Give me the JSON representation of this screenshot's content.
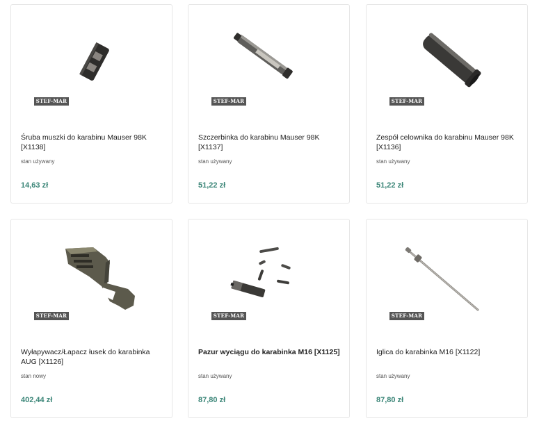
{
  "products": [
    {
      "title": "Śruba muszki do karabinu Mauser 98K [X1138]",
      "condition": "stan używany",
      "price": "14,63 zł",
      "watermark": "STEF-MAR",
      "image": "front-sight-screw"
    },
    {
      "title": "Szczerbinka do karabinu Mauser 98K [X1137]",
      "condition": "stan używany",
      "price": "51,22 zł",
      "watermark": "STEF-MAR",
      "image": "rear-sight-leaf"
    },
    {
      "title": "Zespół celownika do karabinu Mauser 98K [X1136]",
      "condition": "stan używany",
      "price": "51,22 zł",
      "watermark": "STEF-MAR",
      "image": "sight-tube"
    },
    {
      "title": "Wyłapywacz/Łapacz łusek do karabinka AUG [X1126]",
      "condition": "stan nowy",
      "price": "402,44 zł",
      "watermark": "STEF-MAR",
      "image": "brass-catcher"
    },
    {
      "title": "Pazur wyciągu do karabinka M16 [X1125]",
      "condition": "stan używany",
      "price": "87,80 zł",
      "watermark": "STEF-MAR",
      "image": "extractor-claw-parts"
    },
    {
      "title": "Iglica do karabinka M16 [X1122]",
      "condition": "stan używany",
      "price": "87,80 zł",
      "watermark": "STEF-MAR",
      "image": "firing-pin"
    }
  ],
  "colors": {
    "price": "#3a8577",
    "border": "#e6e6e6"
  }
}
